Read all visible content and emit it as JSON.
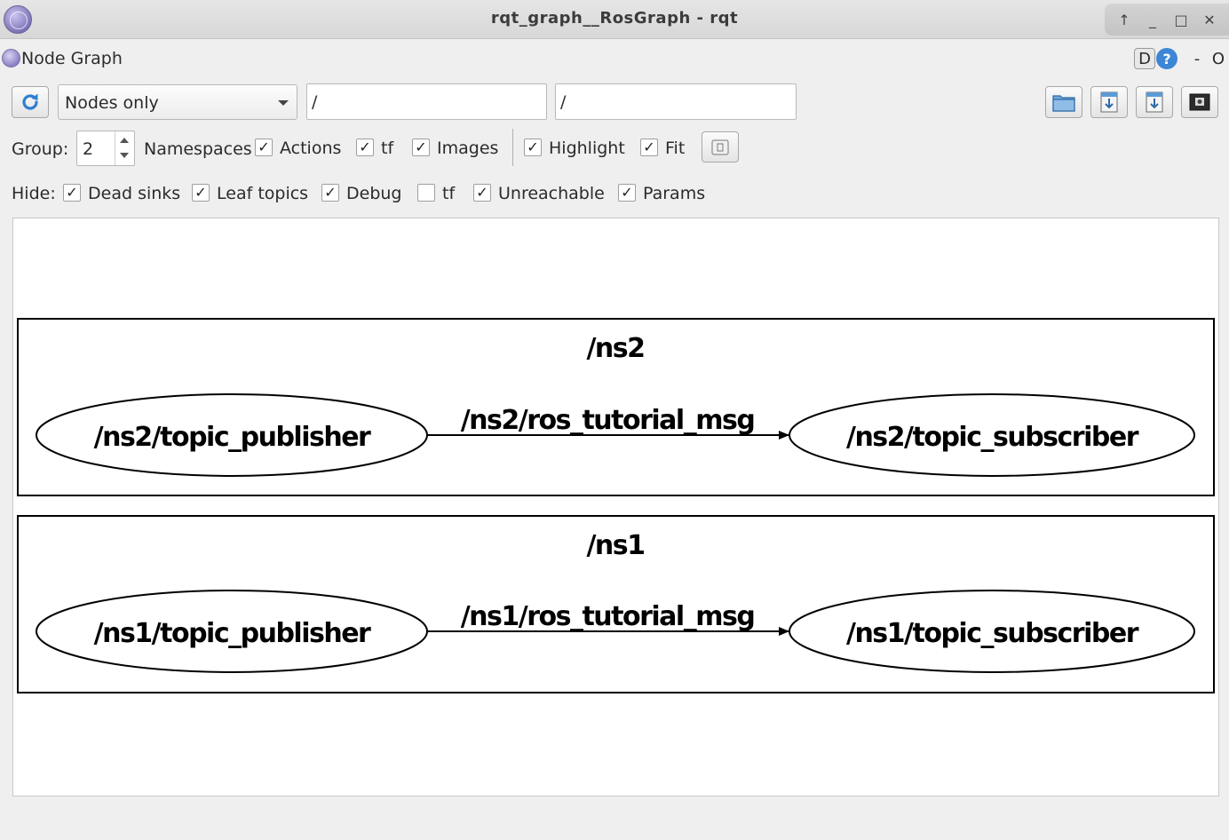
{
  "window": {
    "title": "rqt_graph__RosGraph - rqt",
    "controls": {
      "up": "↑",
      "minimize": "_",
      "maximize": "□",
      "close": "✕"
    }
  },
  "plugin": {
    "title": "Node Graph",
    "d_label": "D",
    "help_label": "?",
    "min_label": "-",
    "close_label": "O"
  },
  "toolbar": {
    "graph_mode": "Nodes only",
    "filter_nodes": "/",
    "filter_topics": "/"
  },
  "group_row": {
    "group_label": "Group:",
    "group_value": "2",
    "namespaces_label": "Namespaces",
    "actions_label": "Actions",
    "tf_label": "tf",
    "images_label": "Images",
    "highlight_label": "Highlight",
    "fit_label": "Fit",
    "check": "✓"
  },
  "hide_row": {
    "hide_label": "Hide:",
    "dead_sinks_label": "Dead sinks",
    "leaf_topics_label": "Leaf topics",
    "debug_label": "Debug",
    "tf_label": "tf",
    "unreachable_label": "Unreachable",
    "params_label": "Params"
  },
  "graph": {
    "clusters": [
      {
        "name": "/ns2",
        "publisher": "/ns2/topic_publisher",
        "topic": "/ns2/ros_tutorial_msg",
        "subscriber": "/ns2/topic_subscriber"
      },
      {
        "name": "/ns1",
        "publisher": "/ns1/topic_publisher",
        "topic": "/ns1/ros_tutorial_msg",
        "subscriber": "/ns1/topic_subscriber"
      }
    ]
  },
  "colors": {
    "accent_blue": "#3d86d6",
    "canvas_bg": "#ffffff",
    "window_bg": "#efefef"
  }
}
